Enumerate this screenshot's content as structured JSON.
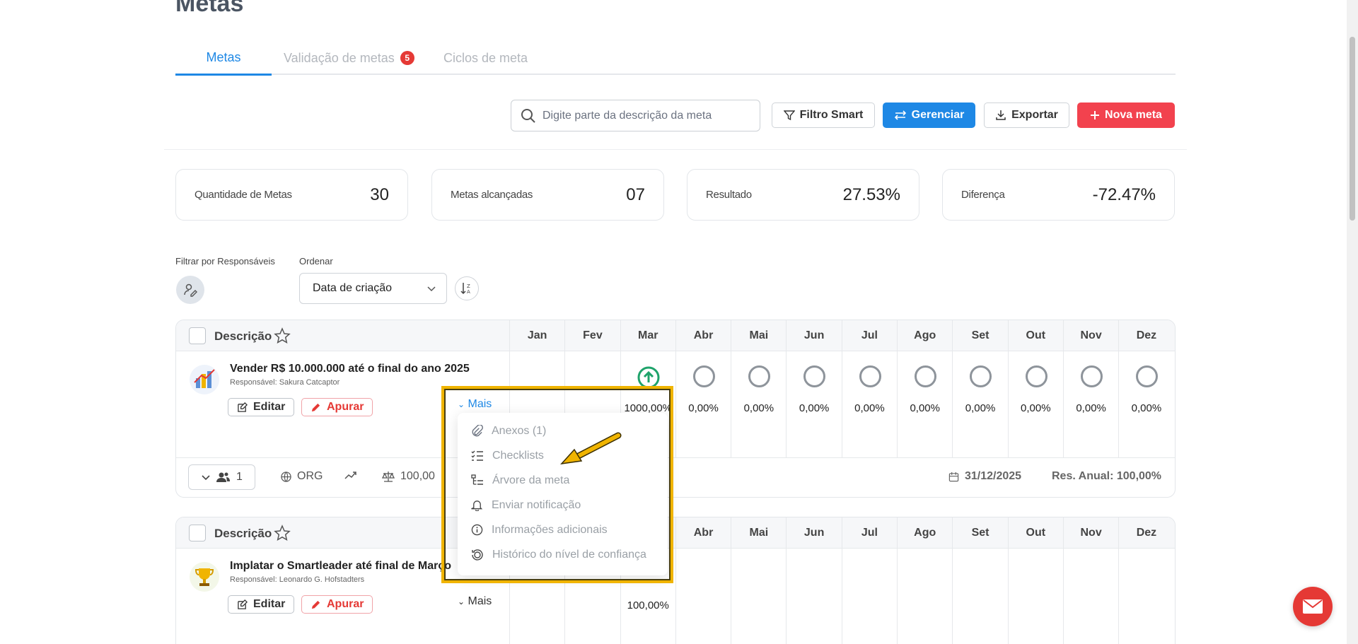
{
  "page": {
    "title": "Metas"
  },
  "tabs": [
    {
      "label": "Metas",
      "active": true
    },
    {
      "label": "Validação de metas",
      "badge": "5"
    },
    {
      "label": "Ciclos de meta"
    }
  ],
  "toolbar": {
    "search_placeholder": "Digite parte da descrição da meta",
    "filter_smart": "Filtro Smart",
    "manage": "Gerenciar",
    "export": "Exportar",
    "new_goal": "Nova meta"
  },
  "stats": [
    {
      "label": "Quantidade de Metas",
      "value": "30"
    },
    {
      "label": "Metas alcançadas",
      "value": "07"
    },
    {
      "label": "Resultado",
      "value": "27.53%"
    },
    {
      "label": "Diferença",
      "value": "-72.47%"
    }
  ],
  "filters": {
    "responsaveis_label": "Filtrar por Responsáveis",
    "order_label": "Ordenar",
    "order_value": "Data de criação"
  },
  "table": {
    "desc_header": "Descrição",
    "months": [
      "Jan",
      "Fev",
      "Mar",
      "Abr",
      "Mai",
      "Jun",
      "Jul",
      "Ago",
      "Set",
      "Out",
      "Nov",
      "Dez"
    ]
  },
  "goals": [
    {
      "title": "Vender R$ 10.000.000 até o final do ano 2025",
      "responsible": "Responsável: Sakura Catcaptor",
      "edit": "Editar",
      "apurar": "Apurar",
      "mais": "Mais",
      "month_values": [
        "",
        "",
        "1000,00%",
        "0,00%",
        "0,00%",
        "0,00%",
        "0,00%",
        "0,00%",
        "0,00%",
        "0,00%",
        "0,00%",
        "0,00%"
      ],
      "footer": {
        "people": "1",
        "org": "ORG",
        "weight": "100,00",
        "date": "31/12/2025",
        "annual": "Res. Anual: 100,00%"
      }
    },
    {
      "title": "Implatar o Smartleader até final de Março",
      "responsible": "Responsável: Leonardo G. Hofstadters",
      "edit": "Editar",
      "apurar": "Apurar",
      "mais": "Mais",
      "mar_value": "100,00%"
    }
  ],
  "dropdown": {
    "items": [
      {
        "label": "Anexos (1)",
        "icon": "paperclip-icon"
      },
      {
        "label": "Checklists",
        "icon": "checklist-icon"
      },
      {
        "label": "Árvore da meta",
        "icon": "tree-icon"
      },
      {
        "label": "Enviar notificação",
        "icon": "bell-icon"
      },
      {
        "label": "Informações adicionais",
        "icon": "info-icon"
      },
      {
        "label": "Histórico do nível de confiança",
        "icon": "history-icon"
      }
    ]
  },
  "colors": {
    "accent": "#1e88e5",
    "danger": "#f2424e",
    "success": "#1fa36b",
    "highlight": "#f0b400"
  }
}
